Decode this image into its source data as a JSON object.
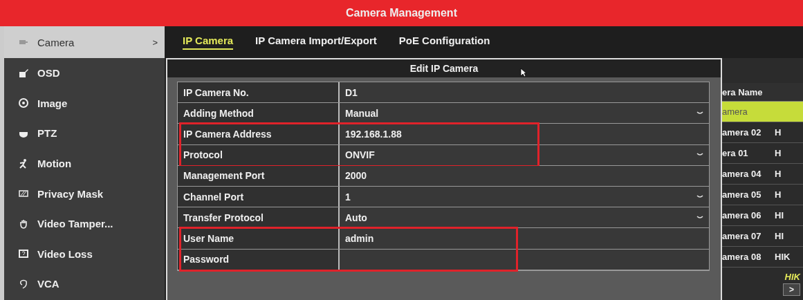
{
  "window": {
    "title": "Camera Management"
  },
  "sidebar": {
    "items": [
      {
        "label": "Camera",
        "selected": true,
        "submenu_mark": ">"
      },
      {
        "label": "OSD",
        "selected": false
      },
      {
        "label": "Image",
        "selected": false
      },
      {
        "label": "PTZ",
        "selected": false
      },
      {
        "label": "Motion",
        "selected": false
      },
      {
        "label": "Privacy Mask",
        "selected": false
      },
      {
        "label": "Video Tamper...",
        "selected": false
      },
      {
        "label": "Video Loss",
        "selected": false
      },
      {
        "label": "VCA",
        "selected": false
      }
    ]
  },
  "tabs": [
    {
      "label": "IP Camera",
      "selected": true
    },
    {
      "label": "IP Camera Import/Export",
      "selected": false
    },
    {
      "label": "PoE Configuration",
      "selected": false
    }
  ],
  "dialog": {
    "title": "Edit IP Camera",
    "field_groups": [
      {
        "highlighted": false,
        "fields": [
          {
            "label": "IP Camera No.",
            "value": "D1",
            "kind": "text"
          },
          {
            "label": "Adding Method",
            "value": "Manual",
            "kind": "dropdown"
          }
        ]
      },
      {
        "highlighted": true,
        "fields": [
          {
            "label": "IP Camera Address",
            "value": "192.168.1.88",
            "kind": "text"
          },
          {
            "label": "Protocol",
            "value": "ONVIF",
            "kind": "dropdown"
          }
        ]
      },
      {
        "highlighted": false,
        "fields": [
          {
            "label": "Management Port",
            "value": "2000",
            "kind": "text"
          },
          {
            "label": "Channel Port",
            "value": "1",
            "kind": "dropdown"
          },
          {
            "label": "Transfer Protocol",
            "value": "Auto",
            "kind": "dropdown"
          }
        ]
      },
      {
        "highlighted": true,
        "fields": [
          {
            "label": "User Name",
            "value": "admin",
            "kind": "text"
          },
          {
            "label": "Password",
            "kind": "password"
          }
        ]
      }
    ]
  },
  "camera_table": {
    "columns": [
      "era Name"
    ],
    "rows": [
      {
        "column_1": "amera",
        "selected": true
      },
      {
        "column_1": "amera 02",
        "column_2": "H",
        "selected": false
      },
      {
        "column_1": "era 01",
        "column_2": "H",
        "selected": false
      },
      {
        "column_1": "amera 04",
        "column_2": "H",
        "selected": false
      },
      {
        "column_1": "amera 05",
        "column_2": "H",
        "selected": false
      },
      {
        "column_1": "amera 06",
        "column_2": "HI",
        "selected": false
      },
      {
        "column_1": "amera 07",
        "column_2": "HI",
        "selected": false
      },
      {
        "column_1": "amera 08",
        "column_2": "HIK",
        "selected": false
      }
    ],
    "footer_text": "HIK",
    "next_button": ">"
  }
}
